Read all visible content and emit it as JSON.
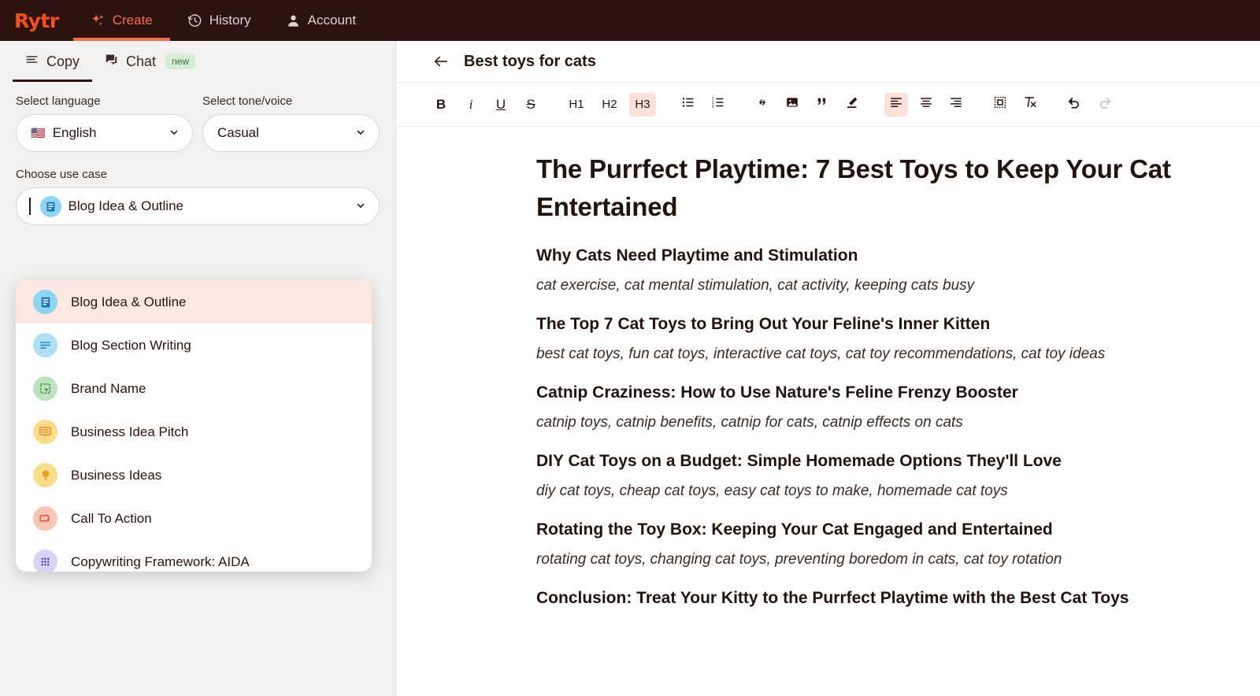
{
  "topnav": {
    "brand": "Rytr",
    "items": [
      {
        "label": "Create",
        "icon": "sparkle-icon",
        "active": true
      },
      {
        "label": "History",
        "icon": "clock-history-icon",
        "active": false
      },
      {
        "label": "Account",
        "icon": "person-icon",
        "active": false
      }
    ]
  },
  "subtabs": {
    "copy": "Copy",
    "chat": "Chat",
    "chat_badge": "new"
  },
  "form": {
    "language_label": "Select language",
    "language_value": "English",
    "language_flag": "🇺🇸",
    "tone_label": "Select tone/voice",
    "tone_value": "Casual",
    "usecase_label": "Choose use case",
    "usecase_value": "Blog Idea & Outline"
  },
  "dropdown": {
    "items": [
      {
        "label": "Blog Idea & Outline",
        "icon": "document-lines-icon",
        "bg": "#8ED5F5",
        "fg": "#1878B8",
        "selected": true
      },
      {
        "label": "Blog Section Writing",
        "icon": "text-lines-icon",
        "bg": "#AFE0F7",
        "fg": "#2A8FCF",
        "selected": false
      },
      {
        "label": "Brand Name",
        "icon": "selection-cursor-icon",
        "bg": "#BBE3BE",
        "fg": "#2E7D32",
        "selected": false
      },
      {
        "label": "Business Idea Pitch",
        "icon": "presentation-icon",
        "bg": "#FBDC8A",
        "fg": "#E08A1E",
        "selected": false
      },
      {
        "label": "Business Ideas",
        "icon": "lightbulb-icon",
        "bg": "#FBDC8A",
        "fg": "#E6A020",
        "selected": false
      },
      {
        "label": "Call To Action",
        "icon": "cta-button-icon",
        "bg": "#FAC6B4",
        "fg": "#E04E2A",
        "selected": false
      },
      {
        "label": "Copywriting Framework: AIDA",
        "icon": "grid-dots-icon",
        "bg": "#D6D4F5",
        "fg": "#4A3FBF",
        "selected": false
      }
    ]
  },
  "editor": {
    "doc_title": "Best toys for cats",
    "toolbar": {
      "bold": "B",
      "italic": "i",
      "underline": "U",
      "strikethrough": "S",
      "h1": "H1",
      "h2": "H2",
      "h3": "H3",
      "active_heading": "H3",
      "active_align": "align-left",
      "bullet_list": "bullet-list-icon",
      "numbered_list": "numbered-list-icon",
      "link": "link-icon",
      "image": "image-icon",
      "quote": "quote-icon",
      "highlighter": "highlighter-pen-icon",
      "align_left": "align-left-icon",
      "align_center": "align-center-icon",
      "align_right": "align-right-icon",
      "border": "border-box-icon",
      "clear_format": "clear-formatting-icon",
      "undo": "undo-icon",
      "redo": "redo-icon"
    }
  },
  "document": {
    "title": "The Purrfect Playtime: 7 Best Toys to Keep Your Cat Entertained",
    "sections": [
      {
        "heading": "Why Cats Need Playtime and Stimulation",
        "keywords": "cat exercise, cat mental stimulation, cat activity, keeping cats busy"
      },
      {
        "heading": "The Top 7 Cat Toys to Bring Out Your Feline's Inner Kitten",
        "keywords": "best cat toys, fun cat toys, interactive cat toys, cat toy recommendations, cat toy ideas"
      },
      {
        "heading": "Catnip Craziness: How to Use Nature's Feline Frenzy Booster",
        "keywords": "catnip toys, catnip benefits, catnip for cats, catnip effects on cats"
      },
      {
        "heading": "DIY Cat Toys on a Budget: Simple Homemade Options They'll Love",
        "keywords": "diy cat toys, cheap cat toys, easy cat toys to make, homemade cat toys"
      },
      {
        "heading": "Rotating the Toy Box: Keeping Your Cat Engaged and Entertained",
        "keywords": "rotating cat toys, changing cat toys, preventing boredom in cats, cat toy rotation"
      },
      {
        "heading": "Conclusion: Treat Your Kitty to the Purrfect Playtime with the Best Cat Toys",
        "keywords": ""
      }
    ]
  },
  "colors": {
    "brand_orange": "#FF4F17",
    "nav_bg": "#2B1310",
    "active_highlight": "#FDE0D7",
    "selected_item": "#FDE8E2",
    "badge_green": "#D4EDD4"
  }
}
